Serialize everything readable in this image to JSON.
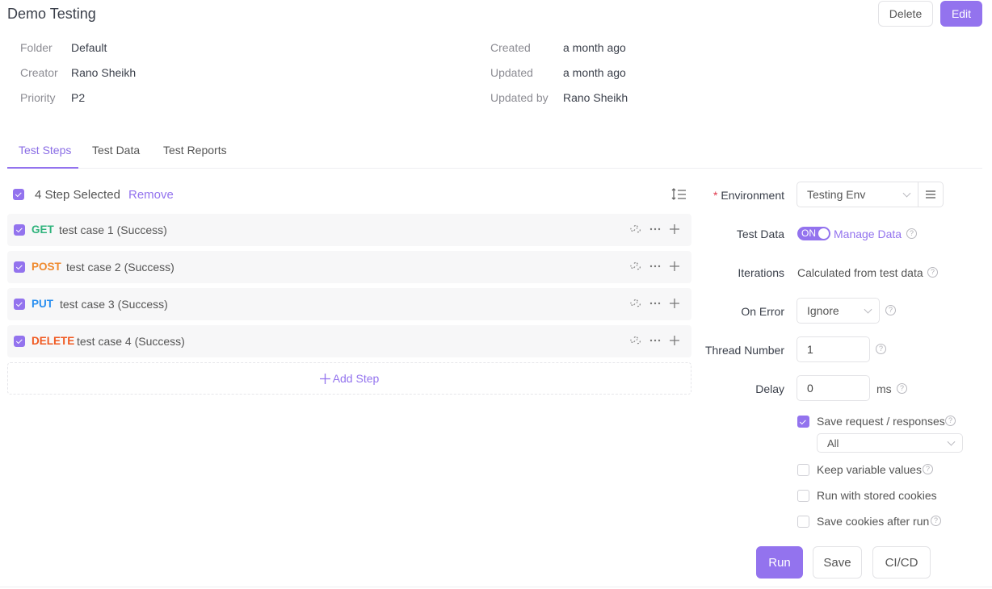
{
  "header": {
    "title": "Demo Testing",
    "delete_label": "Delete",
    "edit_label": "Edit"
  },
  "meta": {
    "left": [
      {
        "label": "Folder",
        "value": "Default"
      },
      {
        "label": "Creator",
        "value": "Rano Sheikh"
      },
      {
        "label": "Priority",
        "value": "P2"
      }
    ],
    "right": [
      {
        "label": "Created",
        "value": "a month ago"
      },
      {
        "label": "Updated",
        "value": "a month ago"
      },
      {
        "label": "Updated by",
        "value": "Rano Sheikh"
      }
    ]
  },
  "tabs": [
    {
      "label": "Test Steps",
      "active": true
    },
    {
      "label": "Test Data",
      "active": false
    },
    {
      "label": "Test Reports",
      "active": false
    }
  ],
  "steps_panel": {
    "selected_text": "4 Step Selected",
    "remove_label": "Remove",
    "add_step_label": "Add Step",
    "steps": [
      {
        "method": "GET",
        "method_color": "#2fb37c",
        "name": "test case 1 (Success)",
        "checked": true
      },
      {
        "method": "POST",
        "method_color": "#ef8a2e",
        "name": "test case 2 (Success)",
        "checked": true
      },
      {
        "method": "PUT",
        "method_color": "#2a8ff0",
        "name": "test case 3 (Success)",
        "checked": true
      },
      {
        "method": "DELETE",
        "method_color": "#f05a22",
        "name": "test case 4 (Success)",
        "checked": true
      }
    ]
  },
  "run_config": {
    "environment_label": "Environment",
    "environment_required": "*",
    "environment_value": "Testing Env",
    "test_data_label": "Test Data",
    "test_data_toggle": "ON",
    "manage_data_label": "Manage Data",
    "iterations_label": "Iterations",
    "iterations_value": "Calculated from test data",
    "on_error_label": "On Error",
    "on_error_value": "Ignore",
    "thread_number_label": "Thread Number",
    "thread_number_value": "1",
    "delay_label": "Delay",
    "delay_value": "0",
    "delay_unit": "ms",
    "save_request_label": "Save request / responses",
    "save_request_checked": true,
    "save_request_scope": "All",
    "keep_variable_label": "Keep variable values",
    "keep_variable_checked": false,
    "stored_cookies_label": "Run with stored cookies",
    "stored_cookies_checked": false,
    "save_cookies_label": "Save cookies after run",
    "save_cookies_checked": false,
    "help_glyph": "?"
  },
  "actions": {
    "run_label": "Run",
    "save_label": "Save",
    "cicd_label": "CI/CD"
  }
}
